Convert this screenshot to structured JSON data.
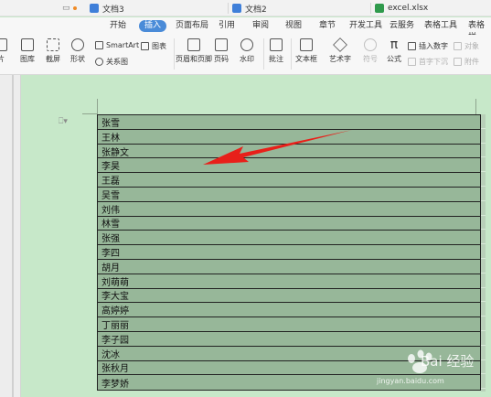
{
  "tabs": [
    {
      "label": "文档3",
      "active": false
    },
    {
      "label": "文档2",
      "active": false
    },
    {
      "label": "excel.xlsx",
      "active": false
    }
  ],
  "menu": [
    {
      "label": "开始"
    },
    {
      "label": "插入"
    },
    {
      "label": "页面布局"
    },
    {
      "label": "引用"
    },
    {
      "label": "审阅"
    },
    {
      "label": "视图"
    },
    {
      "label": "章节"
    },
    {
      "label": "开发工具"
    },
    {
      "label": "云服务"
    },
    {
      "label": "表格工具"
    },
    {
      "label": "表格样"
    }
  ],
  "ribbon": {
    "picture": "片",
    "gallery": "图库",
    "screenshot": "截屏",
    "shape": "形状",
    "smartart": "SmartArt",
    "chart": "图表",
    "relation": "关系图",
    "header_footer": "页眉和页脚",
    "page_num": "页码",
    "watermark": "水印",
    "comment": "批注",
    "textbox": "文本框",
    "wordart": "艺术字",
    "symbol": "符号",
    "formula": "公式",
    "insert_number": "插入数字",
    "object": "对象",
    "first_char": "首字下沉",
    "attachment": "附件"
  },
  "table_rows": [
    "张雪",
    "王林",
    "张静文",
    "李昊",
    "王磊",
    "吴雪",
    "刘伟",
    "林雪",
    "张强",
    "李四",
    "胡月",
    "刘萌萌",
    "李大宝",
    "高婷婷",
    "丁丽丽",
    "李子园",
    "沈冰",
    "张秋月",
    "李梦娇"
  ],
  "watermark": {
    "brand": "Bai 经验",
    "url": "jingyan.baidu.com"
  },
  "colors": {
    "accent": "#4a8bd8",
    "page_bg": "#c7e8c9",
    "table_fill": "#97b799",
    "arrow": "#e8201a"
  }
}
